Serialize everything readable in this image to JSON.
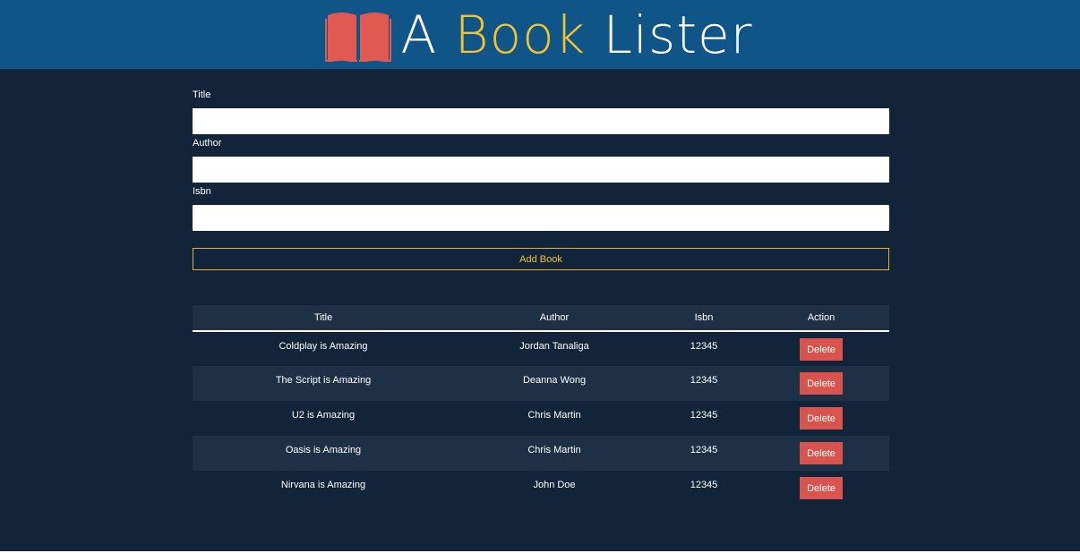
{
  "header": {
    "title_part_a": "A",
    "title_part_book": "Book",
    "title_part_lister": "Lister",
    "icon": "open-book-icon",
    "colors": {
      "header_bg": "#0f5587",
      "book_icon": "#e05a52",
      "accent_yellow": "#f4c430"
    }
  },
  "form": {
    "title_label": "Title",
    "title_value": "",
    "author_label": "Author",
    "author_value": "",
    "isbn_label": "Isbn",
    "isbn_value": "",
    "submit_label": "Add Book"
  },
  "table": {
    "headers": {
      "title": "Title",
      "author": "Author",
      "isbn": "Isbn",
      "action": "Action"
    },
    "rows": [
      {
        "title": "Coldplay is Amazing",
        "author": "Jordan Tanaliga",
        "isbn": "12345",
        "action": "Delete"
      },
      {
        "title": "The Script is Amazing",
        "author": "Deanna Wong",
        "isbn": "12345",
        "action": "Delete"
      },
      {
        "title": "U2 is Amazing",
        "author": "Chris Martin",
        "isbn": "12345",
        "action": "Delete"
      },
      {
        "title": "Oasis is Amazing",
        "author": "Chris Martin",
        "isbn": "12345",
        "action": "Delete"
      },
      {
        "title": "Nirvana is Amazing",
        "author": "John Doe",
        "isbn": "12345",
        "action": "Delete"
      }
    ]
  },
  "colors": {
    "page_bg": "#11243a",
    "row_alt_bg": "#1d3045",
    "delete_button": "#d9534f"
  }
}
